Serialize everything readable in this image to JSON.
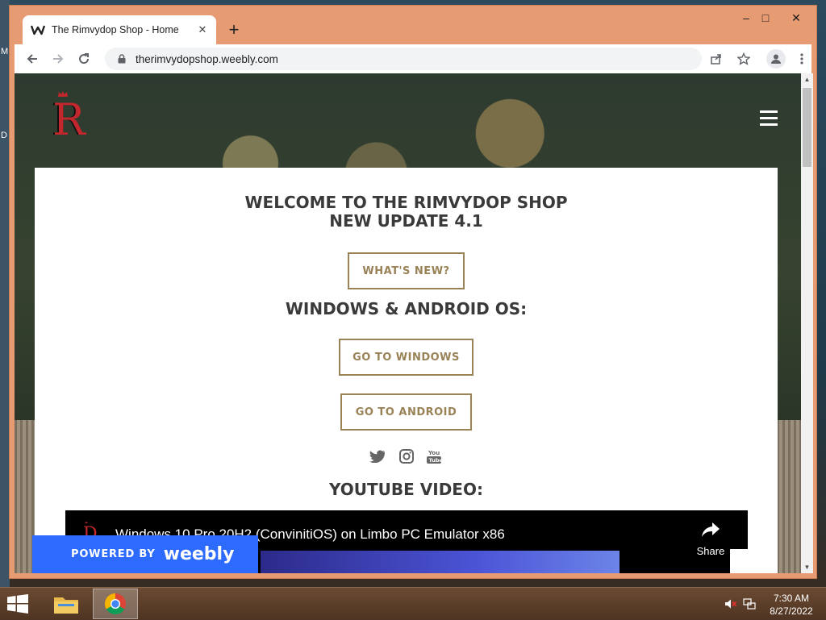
{
  "desktop": {
    "edge_chars": [
      "M",
      "D"
    ]
  },
  "browser": {
    "tab": {
      "title": "The Rimvydop Shop - Home",
      "favicon": "weebly-icon"
    },
    "new_tab": "+",
    "window_controls": {
      "minimize": "–",
      "maximize": "□",
      "close": "✕"
    },
    "url": "therimvydopshop.weebly.com"
  },
  "site": {
    "logo_letter": "R",
    "headline_line1": "WELCOME TO THE RIMVYDOP SHOP",
    "headline_line2": "NEW UPDATE 4.1",
    "whats_new_button": "WHAT'S NEW?",
    "os_title": "WINDOWS & ANDROID OS:",
    "windows_button": "GO TO WINDOWS",
    "android_button": "GO TO ANDROID",
    "social": [
      "twitter-icon",
      "instagram-icon",
      "youtube-icon"
    ],
    "youtube_title": "YOUTUBE VIDEO:",
    "video": {
      "title": "Windows 10 Pro 20H2 (ConvinitiOS) on Limbo PC Emulator x86",
      "share_label": "Share"
    },
    "powered_by": "POWERED BY",
    "weebly_brand": "weebly"
  },
  "taskbar": {
    "time": "7:30 AM",
    "date": "8/27/2022"
  },
  "colors": {
    "window_frame": "#e79b72",
    "button_accent": "#9a8257",
    "weebly_blue": "#2d6bff",
    "logo_red": "#c1272d"
  }
}
